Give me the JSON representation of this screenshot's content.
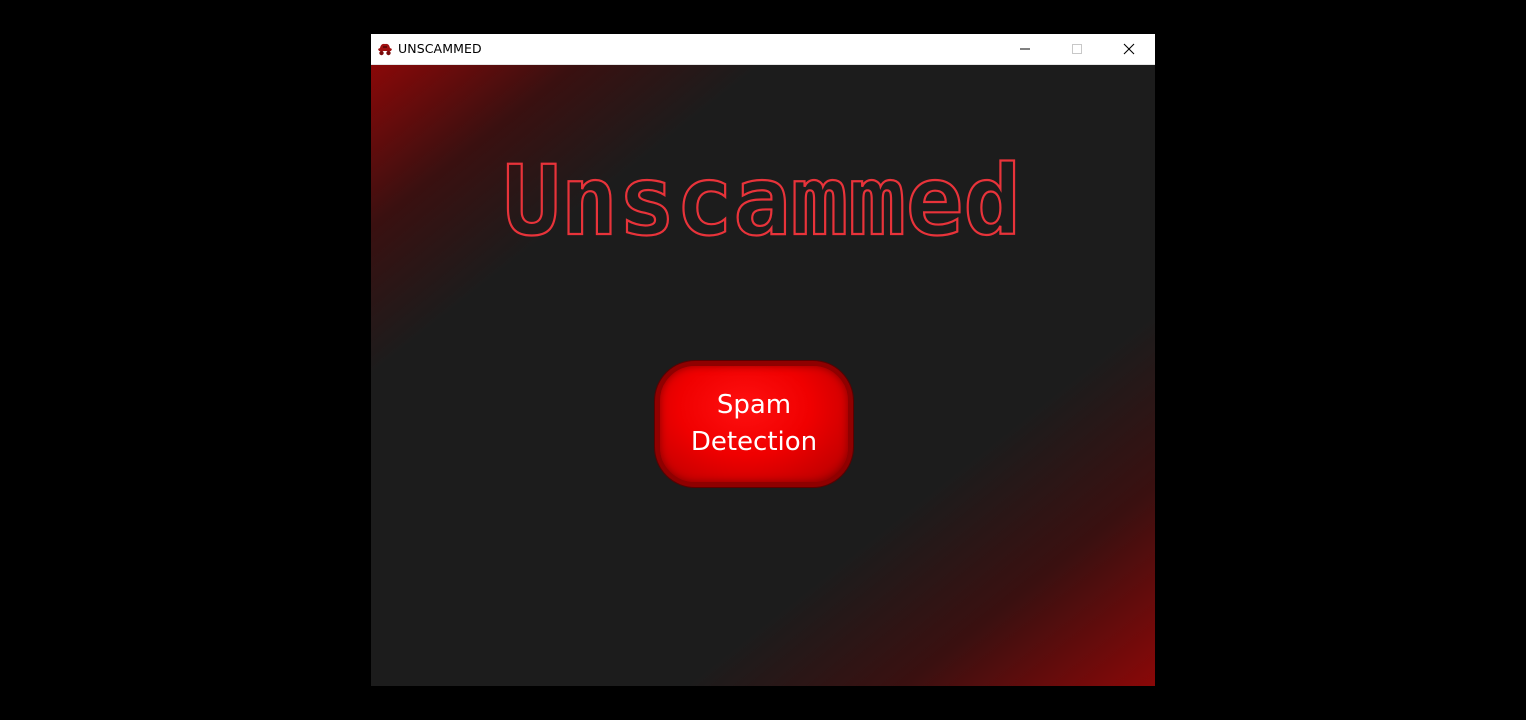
{
  "window": {
    "title": "UNSCAMMED",
    "icon": "app-logo-icon",
    "controls": {
      "minimize_icon": "minimize-icon",
      "maximize_icon": "maximize-icon",
      "close_icon": "close-icon"
    }
  },
  "main": {
    "heading": "Unscammed",
    "spam_button": {
      "line1": "Spam",
      "line2": "Detection"
    }
  },
  "colors": {
    "accent_red": "#ff0000",
    "heading_outline": "#e8333a",
    "background": "#1c1c1c",
    "gradient_corner": "#8a0808",
    "button_border": "#8f0000"
  }
}
